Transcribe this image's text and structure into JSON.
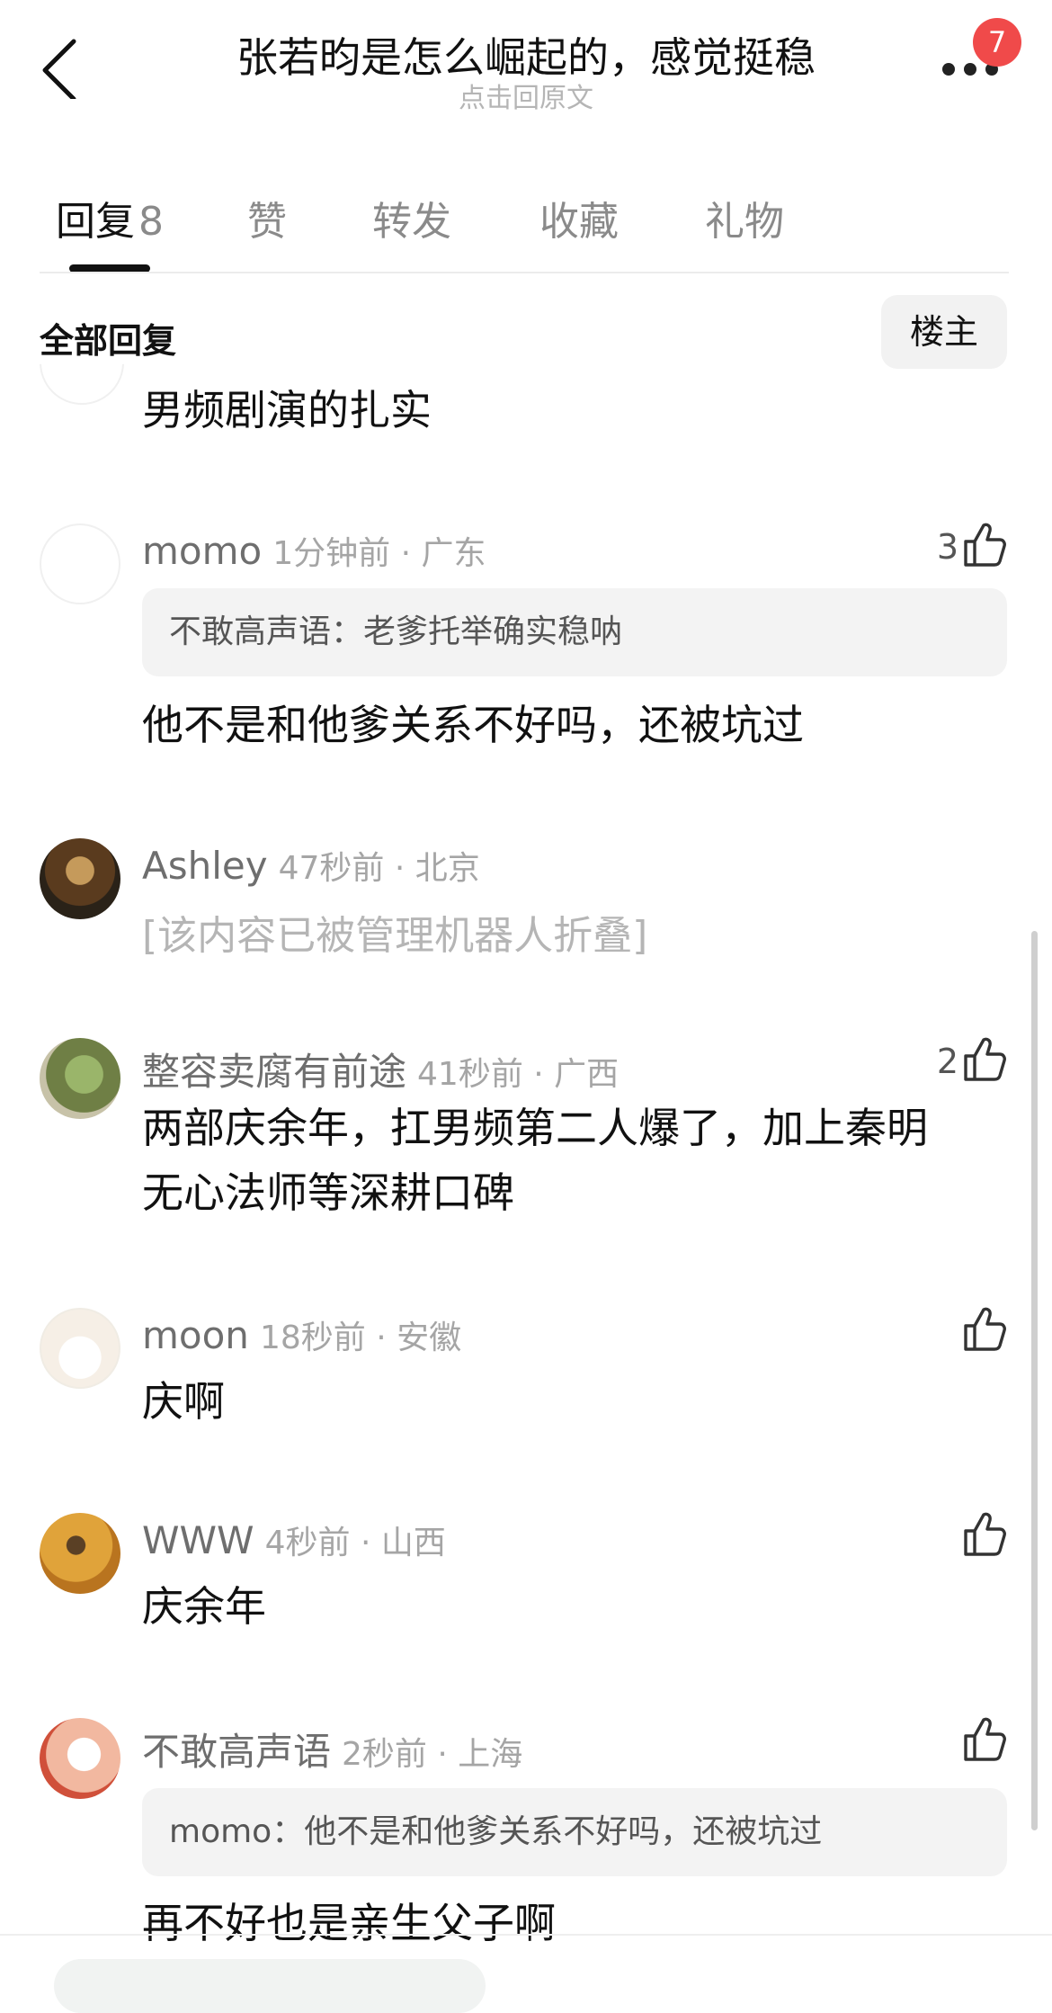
{
  "header": {
    "title": "张若昀是怎么崛起的，感觉挺稳",
    "subtitle": "点击回原文",
    "notification_count": "7"
  },
  "tabs": [
    {
      "label": "回复",
      "count": "8"
    },
    {
      "label": "赞"
    },
    {
      "label": "转发"
    },
    {
      "label": "收藏"
    },
    {
      "label": "礼物"
    }
  ],
  "filter": {
    "all_label": "全部回复",
    "owner_label": "楼主"
  },
  "comments": [
    {
      "text": "男频剧演的扎实"
    },
    {
      "name": "momo",
      "meta": "1分钟前 · 广东",
      "likes": "3",
      "quote": "不敢高声语：老爹托举确实稳呐",
      "text": "他不是和他爹关系不好吗，还被坑过"
    },
    {
      "name": "Ashley",
      "meta": "47秒前 · 北京",
      "text": "[该内容已被管理机器人折叠]"
    },
    {
      "name": "整容卖腐有前途",
      "meta": "41秒前 · 广西",
      "likes": "2",
      "text_line1": "两部庆余年，扛男频第二人爆了，加上秦明",
      "text_line2": "无心法师等深耕口碑"
    },
    {
      "name": "moon",
      "meta": "18秒前 · 安徽",
      "text": "庆啊"
    },
    {
      "name": "WWW",
      "meta": "4秒前 · 山西",
      "text": "庆余年"
    },
    {
      "name": "不敢高声语",
      "meta": "2秒前 · 上海",
      "quote": "momo：他不是和他爹关系不好吗，还被坑过",
      "text": "再不好也是亲生父子啊"
    }
  ],
  "colors": {
    "badge": "#f04a4a",
    "meta_gray": "#a5a5a5",
    "quote_bg": "#f3f3f3"
  },
  "icons": [
    "back-arrow-icon",
    "more-dots-icon",
    "thumbs-up-icon"
  ]
}
